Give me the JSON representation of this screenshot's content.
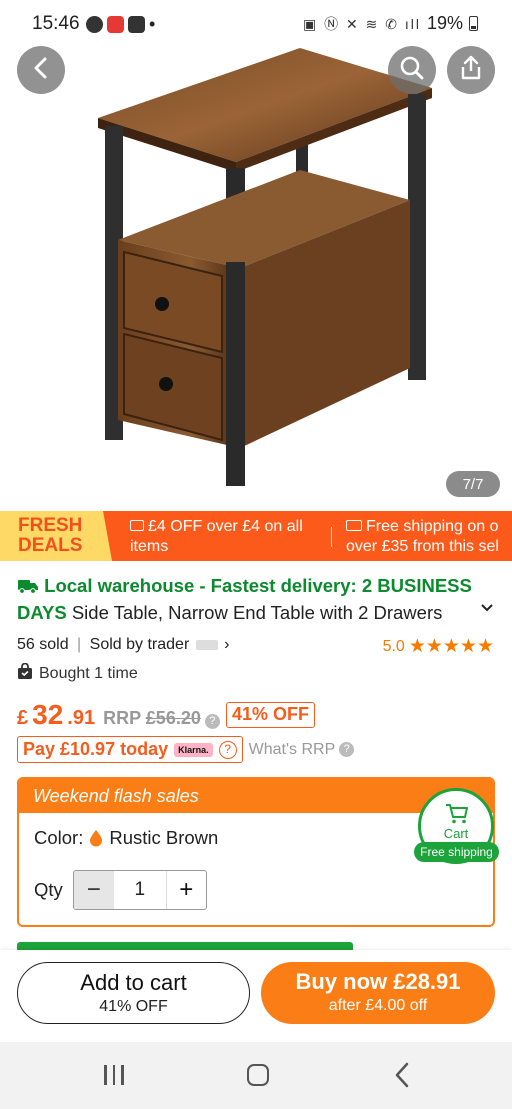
{
  "status_bar": {
    "time": "15:46",
    "battery": "19%"
  },
  "gallery": {
    "counter": "7/7"
  },
  "deals_banner": {
    "brand_line1": "FRESH",
    "brand_line2": "DEALS",
    "offer": "£4 OFF over £4 on all items",
    "shipping": "Free shipping on o over £35 from this sel"
  },
  "product": {
    "delivery_tag": "Local warehouse - Fastest delivery: 2 BUSINESS DAYS",
    "title": "Side Table, Narrow End Table with 2 Drawers",
    "sold_count": "56 sold",
    "sold_by": "Sold by trader",
    "rating": "5.0",
    "stars": "★★★★★",
    "bought": "Bought 1 time"
  },
  "price": {
    "currency": "£",
    "integer": "32",
    "decimal": ".91",
    "rrp_label": "RRP",
    "rrp_value": "£56.20",
    "discount": "41% OFF",
    "pay_today": "Pay £10.97 today",
    "klarna": "Klarna.",
    "whats_rrp": "What's RRP"
  },
  "flash_sale": {
    "heading": "Weekend flash sales",
    "color_label": "Color:",
    "color_value": "Rustic Brown",
    "qty_label": "Qty",
    "qty_value": "1",
    "cart_label": "Cart",
    "free_shipping": "Free shipping"
  },
  "actions": {
    "add_to_cart": "Add to cart",
    "add_to_cart_sub": "41% OFF",
    "buy_now": "Buy now £28.91",
    "buy_now_sub": "after £4.00 off"
  },
  "icons": {
    "back": "back-arrow-icon",
    "search": "search-icon",
    "share": "share-icon",
    "truck": "truck-icon",
    "bag": "bag-icon",
    "cart": "cart-icon"
  },
  "colors": {
    "accent_orange": "#fb7d16",
    "price_orange": "#f45d1c",
    "green": "#0c8a2e"
  }
}
